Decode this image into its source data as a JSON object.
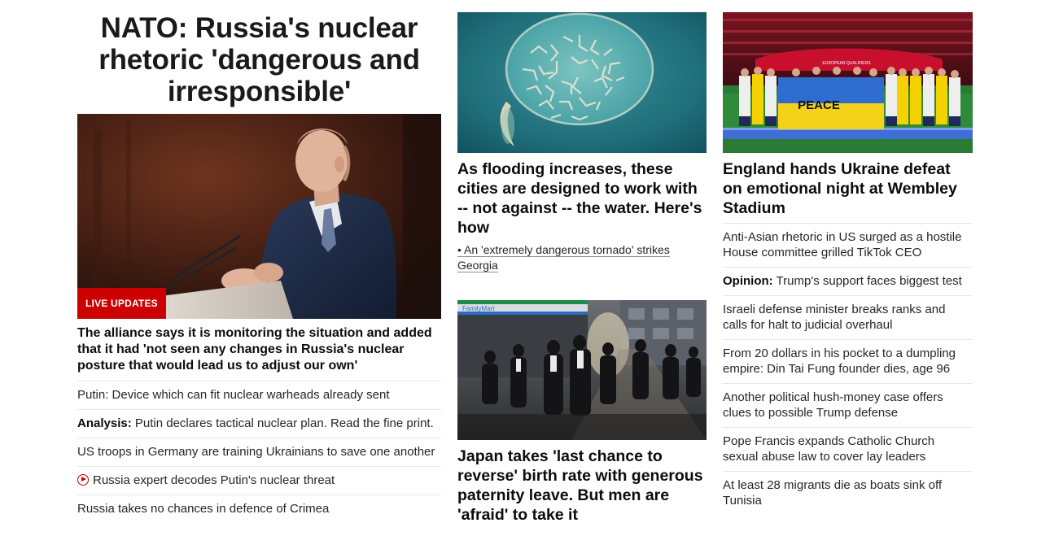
{
  "col1": {
    "headline": "NATO: Russia's nuclear rhetoric 'dangerous and irresponsible'",
    "badge": "LIVE UPDATES",
    "lead_sub": "The alliance says it is monitoring the situation and added that it had 'not seen any changes in Russia's nuclear posture that would lead us to adjust our own'",
    "items": [
      {
        "prefix": "",
        "text": "Putin: Device which can fit nuclear warheads already sent"
      },
      {
        "prefix": "Analysis:",
        "text": " Putin declares tactical nuclear plan. Read the fine print."
      },
      {
        "prefix": "",
        "text": "US troops in Germany are training Ukrainians to save one another"
      },
      {
        "prefix": "",
        "text": "Russia expert decodes Putin's nuclear threat",
        "video": true
      },
      {
        "prefix": "",
        "text": "Russia takes no chances in defence of Crimea"
      }
    ]
  },
  "col2": {
    "story1": {
      "headline": "As flooding increases, these cities are designed to work with -- not against -- the water. Here's how",
      "related": "• An 'extremely dangerous tornado' strikes Georgia"
    },
    "story2": {
      "headline": "Japan takes 'last chance to reverse' birth rate with generous paternity leave. But men are 'afraid' to take it",
      "store_sign": "FamilyMart"
    }
  },
  "col3": {
    "headline": "England hands Ukraine defeat on emotional night at Wembley Stadium",
    "banner_text": "PEACE",
    "items": [
      {
        "prefix": "",
        "text": "Anti-Asian rhetoric in US surged as a hostile House committee grilled TikTok CEO"
      },
      {
        "prefix": "Opinion:",
        "text": " Trump's support faces biggest test"
      },
      {
        "prefix": "",
        "text": "Israeli defense minister breaks ranks and calls for halt to judicial overhaul"
      },
      {
        "prefix": "",
        "text": "From 20 dollars in his pocket to a dumpling empire: Din Tai Fung founder dies, age 96"
      },
      {
        "prefix": "",
        "text": "Another political hush-money case offers clues to possible Trump defense"
      },
      {
        "prefix": "",
        "text": "Pope Francis expands Catholic Church sexual abuse law to cover lay leaders"
      },
      {
        "prefix": "",
        "text": "At least 28 migrants die as boats sink off Tunisia"
      }
    ]
  },
  "colors": {
    "accent_red": "#cc0000",
    "divider": "#e6e6e6",
    "text": "#0c0c0c"
  }
}
